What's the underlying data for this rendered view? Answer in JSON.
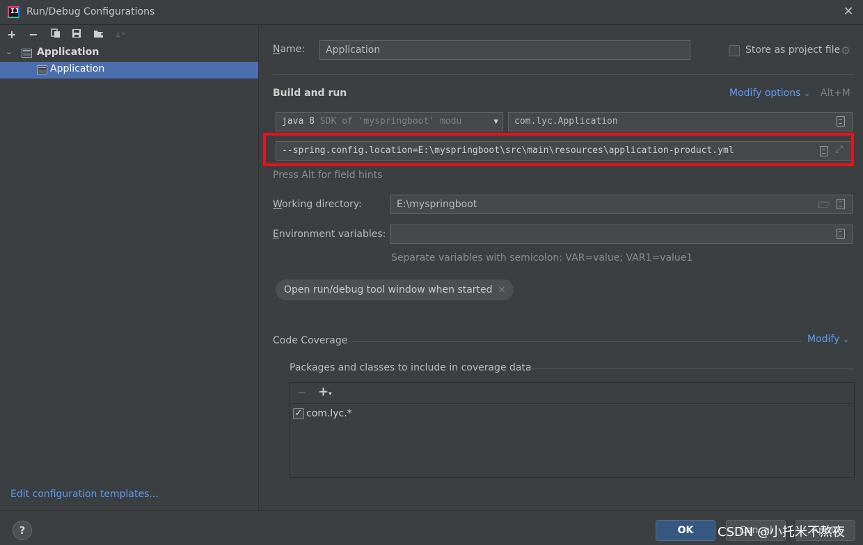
{
  "window": {
    "title": "Run/Debug Configurations",
    "close_icon": "close-icon"
  },
  "left": {
    "toolbar": {
      "add_icon": "+",
      "remove_icon": "−",
      "copy_icon": "copy",
      "save_icon": "save",
      "folder_icon": "new-folder",
      "sort_icon": "sort"
    },
    "tree": {
      "root_label": "Application",
      "child_label": "Application"
    },
    "edit_templates": "Edit configuration templates..."
  },
  "form": {
    "name_label": "Name:",
    "name_value": "Application",
    "store_label": "Store as project file",
    "store_checked": false,
    "build_run_title": "Build and run",
    "modify_options": "Modify options",
    "modify_shortcut": "Alt+M",
    "jre_value": "java 8",
    "jre_hint": "SDK of 'myspringboot' modu",
    "main_class": "com.lyc.Application",
    "program_args": "--spring.config.location=E:\\myspringboot\\src\\main\\resources\\application-product.yml",
    "field_hint": "Press Alt for field hints",
    "working_dir_label": "Working directory:",
    "working_dir_value": "E:\\myspringboot",
    "env_label": "Environment variables:",
    "env_value": "",
    "env_hint": "Separate variables with semicolon: VAR=value; VAR1=value1",
    "chip_label": "Open run/debug tool window when started",
    "coverage_title": "Code Coverage",
    "coverage_modify": "Modify",
    "packages_title": "Packages and classes to include in coverage data",
    "packages": [
      {
        "name": "com.lyc.*",
        "checked": true
      }
    ]
  },
  "buttons": {
    "ok": "OK",
    "cancel": "Cancel",
    "apply": "Apply",
    "help": "?"
  },
  "watermark": "CSDN @小托米不熬夜",
  "colors": {
    "accent": "#589df6",
    "selection": "#4b6eaf",
    "highlight": "#e8121a",
    "ok_button": "#365880"
  }
}
